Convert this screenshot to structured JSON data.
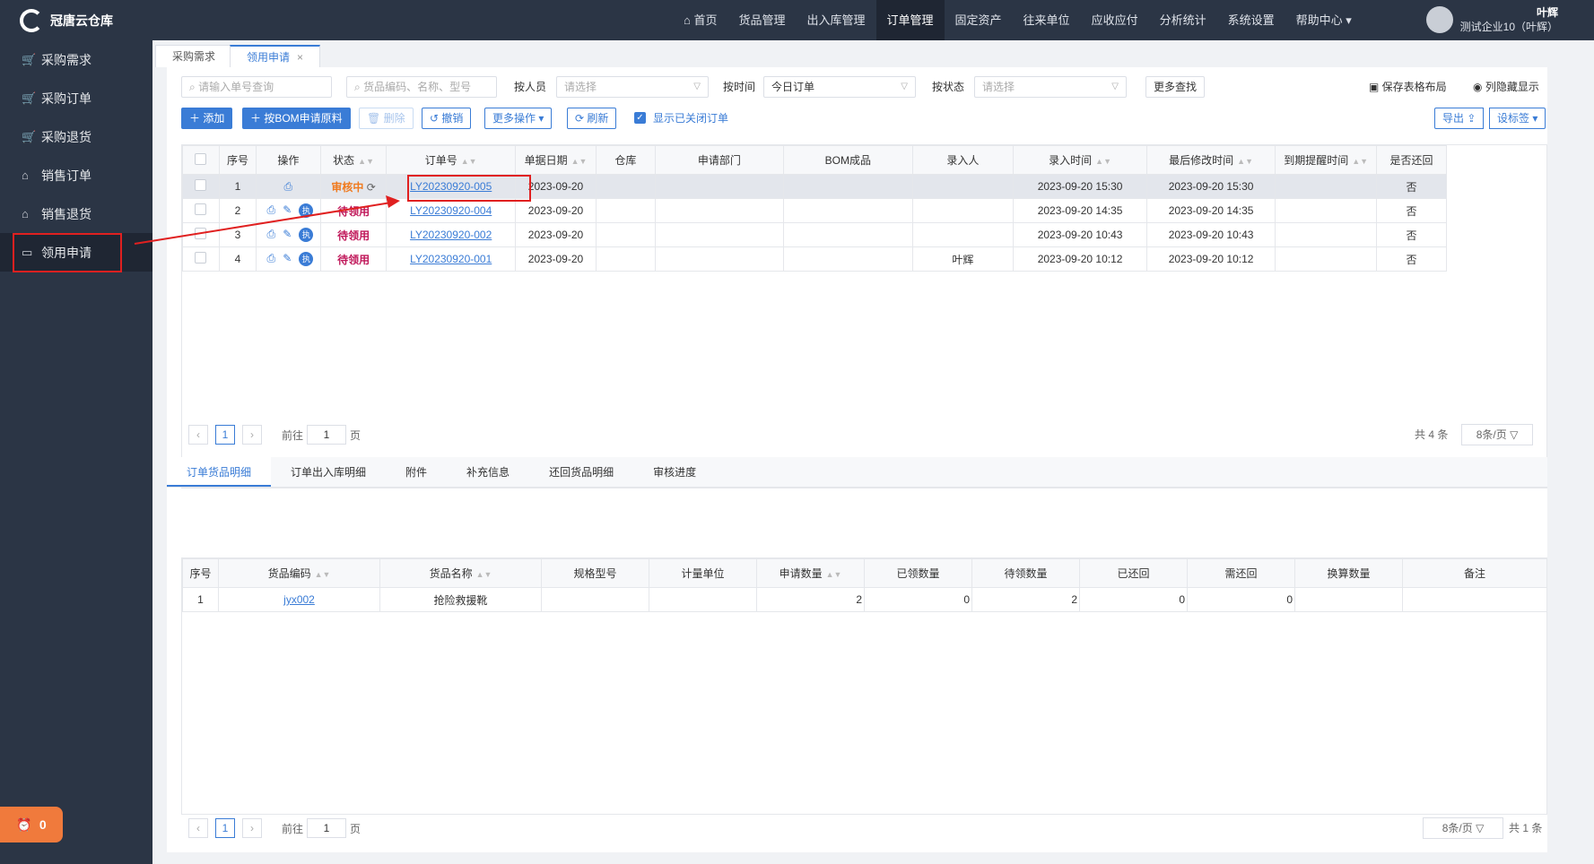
{
  "app": {
    "title": "冠唐云仓库"
  },
  "sidebar": {
    "items": [
      {
        "label": "采购需求",
        "icon": "cart-icon"
      },
      {
        "label": "采购订单",
        "icon": "cart-icon"
      },
      {
        "label": "采购退货",
        "icon": "cart-icon"
      },
      {
        "label": "销售订单",
        "icon": "bag-icon"
      },
      {
        "label": "销售退货",
        "icon": "bag-icon"
      },
      {
        "label": "领用申请",
        "icon": "box-icon"
      }
    ],
    "alarm_count": "0"
  },
  "topnav": {
    "items": [
      "首页",
      "货品管理",
      "出入库管理",
      "订单管理",
      "固定资产",
      "往来单位",
      "应收应付",
      "分析统计",
      "系统设置",
      "帮助中心"
    ],
    "active": "订单管理",
    "user_name": "叶辉",
    "user_company": "测试企业10（叶辉）"
  },
  "page_tabs": [
    {
      "label": "采购需求"
    },
    {
      "label": "领用申请"
    }
  ],
  "filters": {
    "order_no_placeholder": "请输入单号查询",
    "goods_placeholder": "货品编码、名称、型号",
    "entrant_label": "按人员",
    "entrant_placeholder": "请选择",
    "time_label": "按时间",
    "time_value": "今日订单",
    "status_label": "按状态",
    "status_placeholder": "请选择",
    "more_search": "更多查找",
    "save_layout": "保存表格布局",
    "column_hide": "列隐藏显示"
  },
  "toolbar": {
    "add": "添加",
    "bom": "按BOM申请原料",
    "delete": "删除",
    "revoke": "撤销",
    "more_ops": "更多操作",
    "refresh": "刷新",
    "show_closed": "显示已关闭订单",
    "export": "导出",
    "set_tag": "设标签"
  },
  "orders": {
    "headers": [
      "序号",
      "操作",
      "状态",
      "订单号",
      "单据日期",
      "仓库",
      "申请部门",
      "BOM成品",
      "录入人",
      "录入时间",
      "最后修改时间",
      "到期提醒时间",
      "是否还回"
    ],
    "rows": [
      {
        "no": "1",
        "status": "审核中",
        "order": "LY20230920-005",
        "date": "2023-09-20",
        "warehouse": "",
        "dept": "",
        "bom": "",
        "entrant": "",
        "created": "2023-09-20 15:30",
        "modified": "2023-09-20 15:30",
        "due": "",
        "returned": "否"
      },
      {
        "no": "2",
        "status": "待领用",
        "order": "LY20230920-004",
        "date": "2023-09-20",
        "warehouse": "",
        "dept": "",
        "bom": "",
        "entrant": "",
        "created": "2023-09-20 14:35",
        "modified": "2023-09-20 14:35",
        "due": "",
        "returned": "否"
      },
      {
        "no": "3",
        "status": "待领用",
        "order": "LY20230920-002",
        "date": "2023-09-20",
        "warehouse": "",
        "dept": "",
        "bom": "",
        "entrant": "",
        "created": "2023-09-20 10:43",
        "modified": "2023-09-20 10:43",
        "due": "",
        "returned": "否"
      },
      {
        "no": "4",
        "status": "待领用",
        "order": "LY20230920-001",
        "date": "2023-09-20",
        "warehouse": "",
        "dept": "",
        "bom": "",
        "entrant": "叶辉",
        "created": "2023-09-20 10:12",
        "modified": "2023-09-20 10:12",
        "due": "",
        "returned": "否"
      }
    ],
    "badge": "执"
  },
  "pager_top": {
    "page": "1",
    "goto": "前往",
    "goto_val": "1",
    "unit": "页",
    "total": "共 4 条",
    "per_page": "8条/页"
  },
  "detail_tabs": [
    "订单货品明细",
    "订单出入库明细",
    "附件",
    "补充信息",
    "还回货品明细",
    "审核进度"
  ],
  "details": {
    "headers": [
      "序号",
      "货品编码",
      "货品名称",
      "规格型号",
      "计量单位",
      "申请数量",
      "已领数量",
      "待领数量",
      "已还回",
      "需还回",
      "换算数量",
      "备注"
    ],
    "rows": [
      {
        "no": "1",
        "code": "jyx002",
        "name": "抢险救援靴",
        "spec": "",
        "unit": "",
        "qty": "2",
        "received": "0",
        "pending": "2",
        "returned": "0",
        "need_return": "0",
        "conv": "",
        "remark": ""
      }
    ]
  },
  "pager_bottom": {
    "page": "1",
    "goto": "前往",
    "goto_val": "1",
    "unit": "页",
    "per_page": "8条/页",
    "total": "共 1 条"
  }
}
